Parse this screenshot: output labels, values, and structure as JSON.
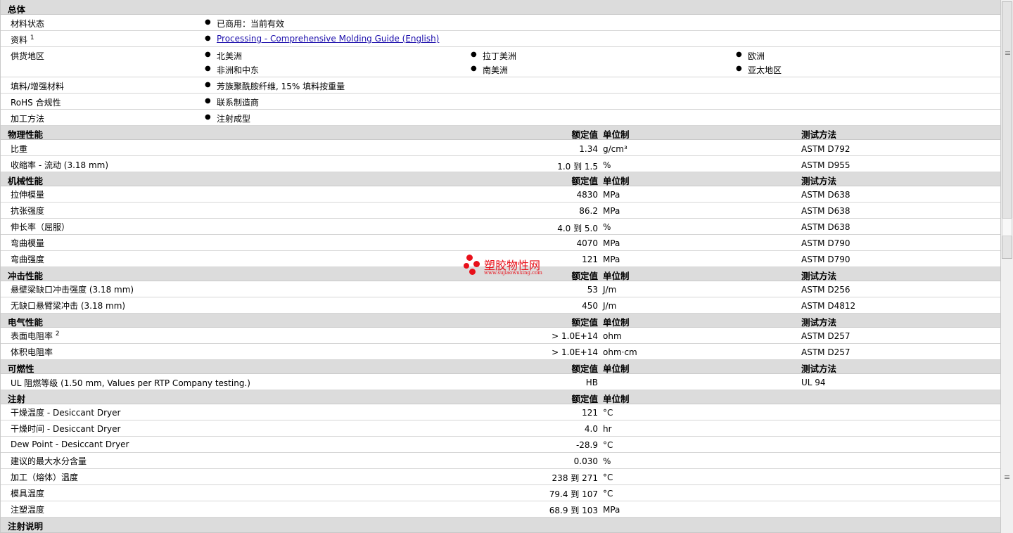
{
  "general": {
    "title": "总体",
    "status_label": "材料状态",
    "status_value": "已商用：当前有效",
    "docs_label": "资料",
    "docs_sup": "1",
    "docs_link": "Processing - Comprehensive Molding Guide (English)",
    "regions_label": "供货地区",
    "regions": [
      "北美洲",
      "拉丁美洲",
      "欧洲",
      "非洲和中东",
      "南美洲",
      "亚太地区"
    ],
    "filler_label": "填料/增强材料",
    "filler_value": "芳族聚酰胺纤维, 15% 填料按重量",
    "rohs_label": "RoHS 合规性",
    "rohs_value": "联系制造商",
    "method_label": "加工方法",
    "method_value": "注射成型"
  },
  "headers": {
    "nominal": "额定值",
    "unit": "单位制",
    "test": "测试方法"
  },
  "physical": {
    "title": "物理性能",
    "rows": [
      {
        "label": "比重",
        "value": "1.34",
        "unit": "g/cm³",
        "test": "ASTM D792"
      },
      {
        "label": "收缩率  - 流动  (3.18 mm)",
        "value": "1.0 到  1.5",
        "unit": "%",
        "test": "ASTM D955"
      }
    ]
  },
  "mechanical": {
    "title": "机械性能",
    "rows": [
      {
        "label": "拉伸模量",
        "value": "4830",
        "unit": "MPa",
        "test": "ASTM D638"
      },
      {
        "label": "抗张强度",
        "value": "86.2",
        "unit": "MPa",
        "test": "ASTM D638"
      },
      {
        "label": "伸长率（屈服）",
        "value": "4.0 到  5.0",
        "unit": "%",
        "test": "ASTM D638"
      },
      {
        "label": "弯曲模量",
        "value": "4070",
        "unit": "MPa",
        "test": "ASTM D790"
      },
      {
        "label": "弯曲强度",
        "value": "121",
        "unit": "MPa",
        "test": "ASTM D790"
      }
    ]
  },
  "impact": {
    "title": "冲击性能",
    "rows": [
      {
        "label": "悬壁梁缺口冲击强度  (3.18 mm)",
        "value": "53",
        "unit": "J/m",
        "test": "ASTM D256"
      },
      {
        "label": "无缺口悬臂梁冲击  (3.18 mm)",
        "value": "450",
        "unit": "J/m",
        "test": "ASTM D4812"
      }
    ]
  },
  "electrical": {
    "title": "电气性能",
    "rows": [
      {
        "label": "表面电阻率",
        "sup": "2",
        "value": "> 1.0E+14",
        "unit": "ohm",
        "test": "ASTM D257"
      },
      {
        "label": "体积电阻率",
        "sup": "",
        "value": "> 1.0E+14",
        "unit": "ohm·cm",
        "test": "ASTM D257"
      }
    ]
  },
  "flammability": {
    "title": "可燃性",
    "rows": [
      {
        "label": "UL 阻燃等级  (1.50 mm, Values per RTP Company testing.)",
        "value": "HB",
        "unit": "",
        "test": "UL 94"
      }
    ]
  },
  "injection": {
    "title": "注射",
    "rows": [
      {
        "label": "干燥温度  - Desiccant Dryer",
        "value": "121",
        "unit": "°C"
      },
      {
        "label": "干燥时间  - Desiccant Dryer",
        "value": "4.0",
        "unit": "hr"
      },
      {
        "label": "Dew Point - Desiccant Dryer",
        "value": "-28.9",
        "unit": "°C"
      },
      {
        "label": "建议的最大水分含量",
        "value": "0.030",
        "unit": "%"
      },
      {
        "label": "加工（熔体）温度",
        "value": "238 到  271",
        "unit": "°C"
      },
      {
        "label": "模具温度",
        "value": "79.4 到  107",
        "unit": "°C"
      },
      {
        "label": "注塑温度",
        "value": "68.9 到  103",
        "unit": "MPa"
      }
    ]
  },
  "injection_notes": {
    "title": "注射说明"
  },
  "watermark": {
    "text": "塑胶物性网",
    "url": "www.sujiaowuxing.com",
    "color": "#e8101a"
  }
}
